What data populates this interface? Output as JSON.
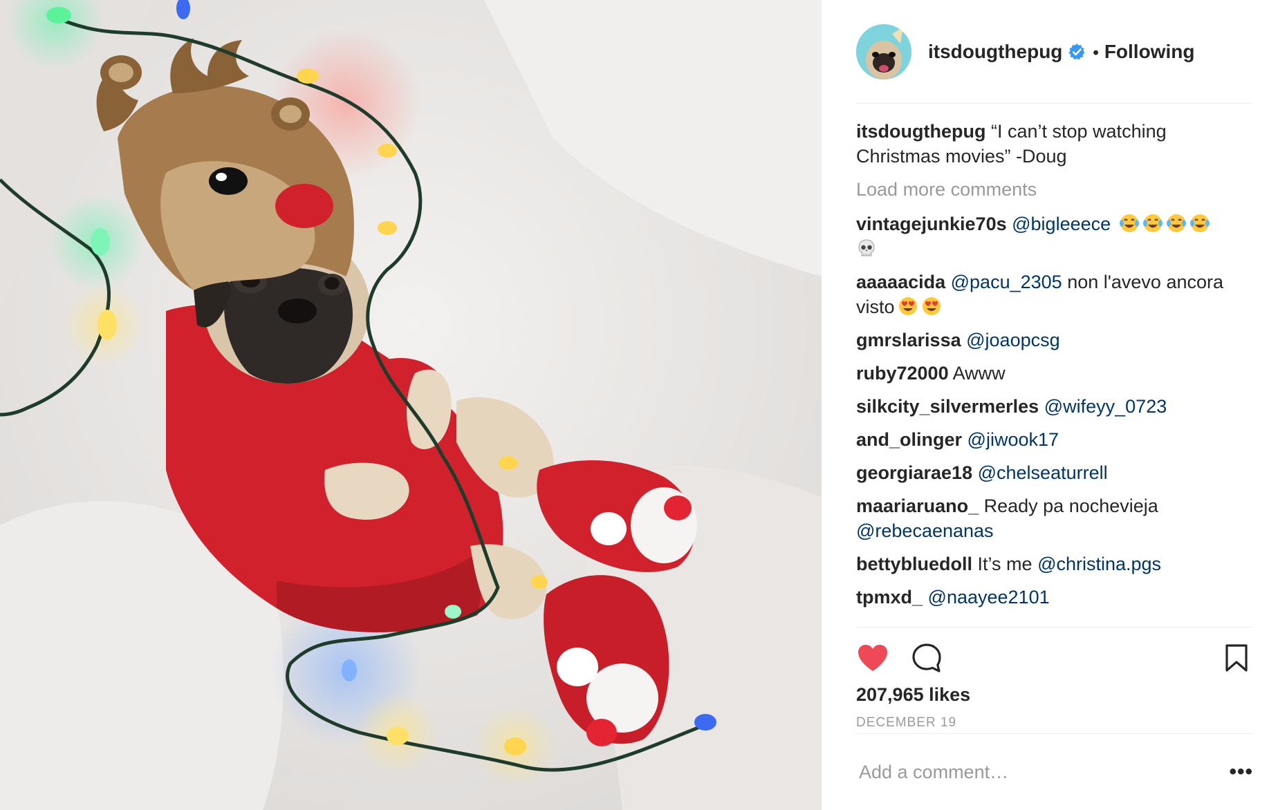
{
  "colors": {
    "text": "#262626",
    "muted": "#999999",
    "mention": "#003569",
    "like_red": "#ed4956",
    "verified_blue": "#3897f0",
    "divider": "#efefef"
  },
  "photo": {
    "alt": ""
  },
  "header": {
    "username": "itsdougthepug",
    "separator": "•",
    "follow_state": "Following",
    "verified_icon": "verified-badge-icon"
  },
  "caption": {
    "username": "itsdougthepug",
    "text": "“I can’t stop watching Christmas movies” -Doug"
  },
  "load_more": "Load more comments",
  "comments": [
    {
      "user": "vintagejunkie70s",
      "mention": "@bigleeece",
      "text": "",
      "emojis": [
        "joy",
        "joy",
        "joy",
        "joy",
        "skull"
      ]
    },
    {
      "user": "aaaaacida",
      "mention": "@pacu_2305",
      "text": "non l'avevo ancora visto",
      "emojis": [
        "heart-eyes",
        "heart-eyes"
      ]
    },
    {
      "user": "gmrslarissa",
      "mention": "@joaopcsg",
      "text": "",
      "emojis": []
    },
    {
      "user": "ruby72000",
      "mention": "",
      "text": "Awww",
      "emojis": []
    },
    {
      "user": "silkcity_silvermerles",
      "mention": "@wifeyy_0723",
      "text": "",
      "emojis": []
    },
    {
      "user": "and_olinger",
      "mention": "@jiwook17",
      "text": "",
      "emojis": []
    },
    {
      "user": "georgiarae18",
      "mention": "@chelseaturrell",
      "text": "",
      "emojis": []
    },
    {
      "user": "maariaruano_",
      "mention": "",
      "text": "Ready pa nochevieja",
      "mention_after": "@rebecaenanas",
      "emojis": []
    },
    {
      "user": "bettybluedoll",
      "mention": "",
      "text": "It’s me",
      "mention_after": "@christina.pgs",
      "emojis": []
    },
    {
      "user": "tpmxd_",
      "mention": "@naayee2101",
      "text": "",
      "emojis": []
    }
  ],
  "actions": {
    "like_icon": "heart-filled-icon",
    "comment_icon": "comment-bubble-icon",
    "save_icon": "bookmark-icon",
    "liked": true
  },
  "likes": "207,965 likes",
  "date": "DECEMBER 19",
  "add_comment": {
    "placeholder": "Add a comment…",
    "value": ""
  },
  "more_options": "•••"
}
